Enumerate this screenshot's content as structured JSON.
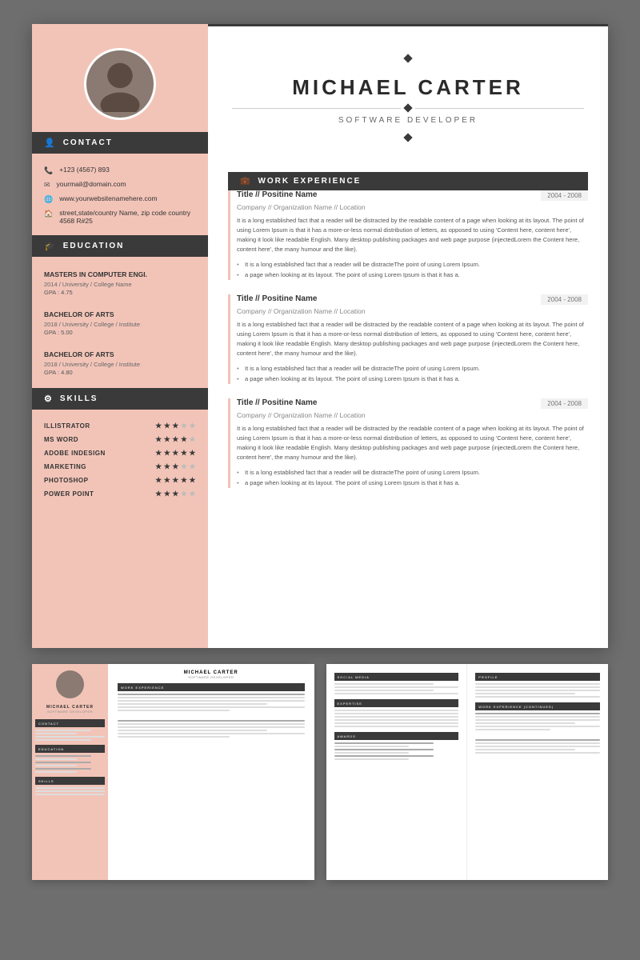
{
  "candidate": {
    "name": "MICHAEL CARTER",
    "title": "SOFTWARE DEVELOPER"
  },
  "contact": {
    "header": "CONTACT",
    "phone": "+123 (4567) 893",
    "email": "yourmail@domain.com",
    "website": "www.yourwebsitenamehere.com",
    "address": "street,state/country Name, zip code country 4568 R#25"
  },
  "education": {
    "header": "EDUCATION",
    "items": [
      {
        "degree": "MASTERS IN COMPUTER ENGI.",
        "year_school": "2014 / University / College Name",
        "gpa": "GPA : 4.75"
      },
      {
        "degree": "BACHELOR OF ARTS",
        "year_school": "2018 / University / College / Institute",
        "gpa": "GPA : 5.00"
      },
      {
        "degree": "BACHELOR OF ARTS",
        "year_school": "2018 / University / College / Institute",
        "gpa": "GPA : 4.80"
      }
    ]
  },
  "skills": {
    "header": "SKILLS",
    "items": [
      {
        "name": "ILLISTRATOR",
        "stars": 3
      },
      {
        "name": "MS WORD",
        "stars": 4
      },
      {
        "name": "ADOBE INDESIGN",
        "stars": 5
      },
      {
        "name": "MARKETING",
        "stars": 3
      },
      {
        "name": "PHOTOSHOP",
        "stars": 5
      },
      {
        "name": "POWER POINT",
        "stars": 3
      }
    ]
  },
  "work_experience": {
    "header": "WORK EXPERIENCE",
    "jobs": [
      {
        "title": "Title // Positine Name",
        "company": "Company // Organization Name // Location",
        "dates": "2004 - 2008",
        "description": "It is a long established fact that a reader will be distracted by the readable content of a page when looking at its layout. The point of using Lorem Ipsum is that it has a more-or-less normal distribution of letters, as opposed to using 'Content here, content here', making it look like readable English. Many desktop publishing packages and web page purpose (injectedLorem the Content here, content here', the many humour and the like).",
        "bullets": [
          "It is a long established fact that a reader will be distracteThe point of using Lorem Ipsum.",
          "a page when looking at its layout. The point of using Lorem Ipsum is that it has a."
        ]
      },
      {
        "title": "Title // Positine Name",
        "company": "Company // Organization Name // Location",
        "dates": "2004 - 2008",
        "description": "It is a long established fact that a reader will be distracted by the readable content of a page when looking at its layout. The point of using Lorem Ipsum is that it has a more-or-less normal distribution of letters, as opposed to using 'Content here, content here', making it look like readable English. Many desktop publishing packages and web page purpose (injectedLorem the Content here, content here', the many humour and the like).",
        "bullets": [
          "It is a long established fact that a reader will be distracteThe point of using Lorem Ipsum.",
          "a page when looking at its layout. The point of using Lorem Ipsum is that it has a."
        ]
      },
      {
        "title": "Title // Positine Name",
        "company": "Company // Organization Name // Location",
        "dates": "2004 - 2008",
        "description": "It is a long established fact that a reader will be distracted by the readable content of a page when looking at its layout. The point of using Lorem Ipsum is that it has a more-or-less normal distribution of letters, as opposed to using 'Content here, content here', making it look like readable English. Many desktop publishing packages and web page purpose (injectedLorem the Content here, content here', the many humour and the like).",
        "bullets": [
          "It is a long established fact that a reader will be distracteThe point of using Lorem Ipsum.",
          "a page when looking at its layout. The point of using Lorem Ipsum is that it has a."
        ]
      }
    ]
  },
  "preview1": {
    "name": "MICHAEL CARTER",
    "title": "SOFTWARE DEVELOPER"
  },
  "preview2_sections": {
    "social_media": "SOCIAL MEDIA",
    "profile": "PROFILE",
    "expertise": "EXPERTISE",
    "awards": "AWARDS",
    "work_exp_cont": "WORK EXPERIENCE (CONTINUED)"
  },
  "icons": {
    "person": "👤",
    "graduation": "🎓",
    "gear": "⚙",
    "briefcase": "💼",
    "phone": "📞",
    "email": "✉",
    "web": "🌐",
    "home": "🏠",
    "twitter": "🐦",
    "facebook": "f",
    "linkedin": "in",
    "instagram": "📷"
  },
  "colors": {
    "sidebar_bg": "#f2c4b8",
    "header_dark": "#3a3a3a",
    "accent": "#f2c4b8",
    "text_dark": "#2a2a2a",
    "text_mid": "#555555",
    "text_light": "#888888"
  }
}
